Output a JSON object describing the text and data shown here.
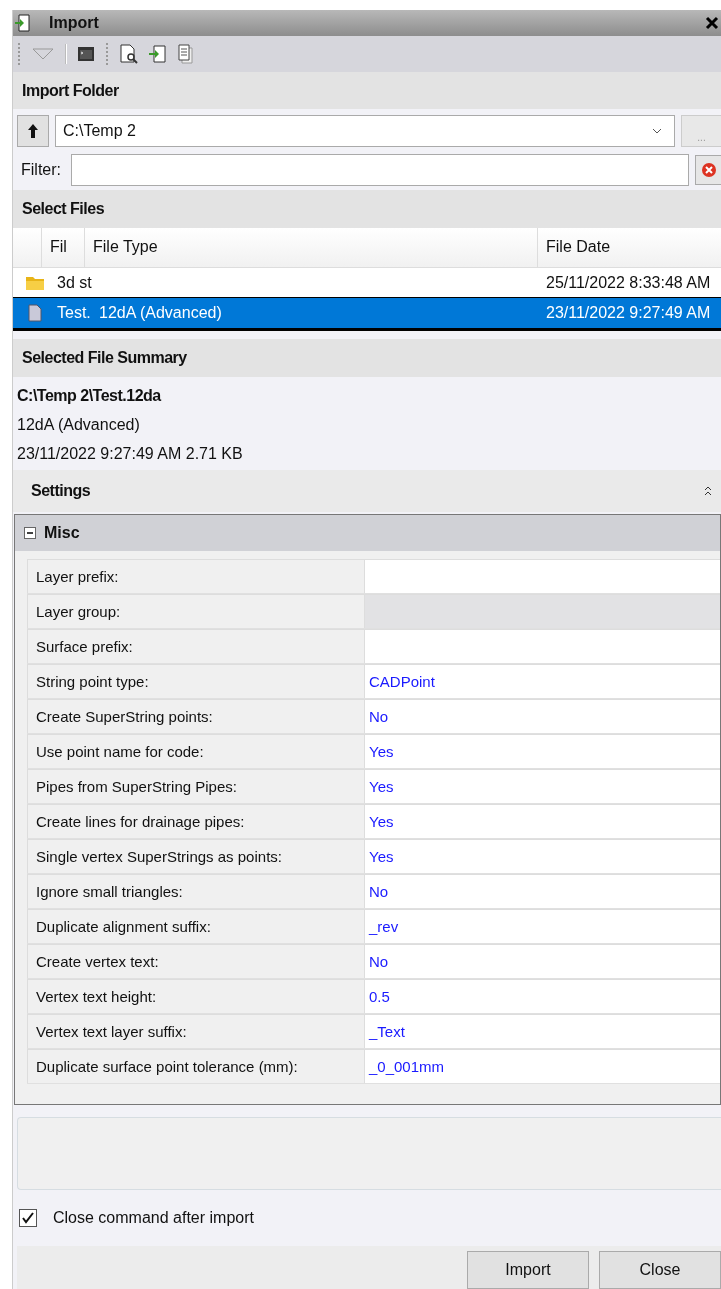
{
  "window": {
    "title": "Import"
  },
  "import_folder": {
    "header": "Import Folder",
    "path": "C:\\Temp 2",
    "browse_label": "...",
    "filter_label": "Filter:"
  },
  "select_files": {
    "header": "Select Files",
    "columns": [
      "Fil",
      "File Type",
      "File Date"
    ],
    "rows": [
      {
        "kind": "folder",
        "name": "3d st",
        "date": "25/11/2022 8:33:48 AM",
        "selected": false
      },
      {
        "kind": "file",
        "name": "Test.",
        "type": "12dA (Advanced)",
        "date": "23/11/2022 9:27:49 AM",
        "selected": true
      }
    ]
  },
  "summary": {
    "header": "Selected File Summary",
    "path": "C:\\Temp 2\\Test.12da",
    "type": "12dA (Advanced)",
    "details": "23/11/2022 9:27:49 AM 2.71 KB"
  },
  "settings": {
    "header": "Settings",
    "group": {
      "name": "Misc",
      "expanded": true
    },
    "properties": [
      {
        "label": "Layer prefix:",
        "disabled": false
      },
      {
        "label": "Layer group:",
        "disabled": true
      },
      {
        "label": "Surface prefix:",
        "disabled": false
      },
      {
        "label": "String point type:",
        "value": "CADPoint",
        "disabled": false
      },
      {
        "label": "Create SuperString points:",
        "value": "No",
        "disabled": false
      },
      {
        "label": "Use point name for code:",
        "value": "Yes",
        "disabled": false
      },
      {
        "label": "Pipes from SuperString Pipes:",
        "value": "Yes",
        "disabled": false
      },
      {
        "label": "Create lines for drainage pipes:",
        "value": "Yes",
        "disabled": false
      },
      {
        "label": "Single vertex SuperStrings as points:",
        "value": "Yes",
        "disabled": false
      },
      {
        "label": "Ignore small triangles:",
        "value": "No",
        "disabled": false
      },
      {
        "label": "Duplicate alignment suffix:",
        "value": "_rev",
        "disabled": false
      },
      {
        "label": "Create vertex text:",
        "value": "No",
        "disabled": false
      },
      {
        "label": "Vertex text height:",
        "value": "0.5",
        "disabled": false
      },
      {
        "label": "Vertex text layer suffix:",
        "value": "_Text",
        "disabled": false
      },
      {
        "label": "Duplicate surface point tolerance (mm):",
        "value": "_0_001mm",
        "disabled": false
      }
    ]
  },
  "close_after_import": {
    "label": "Close command after import",
    "checked": true
  },
  "buttons": [
    "Import",
    "Close"
  ]
}
